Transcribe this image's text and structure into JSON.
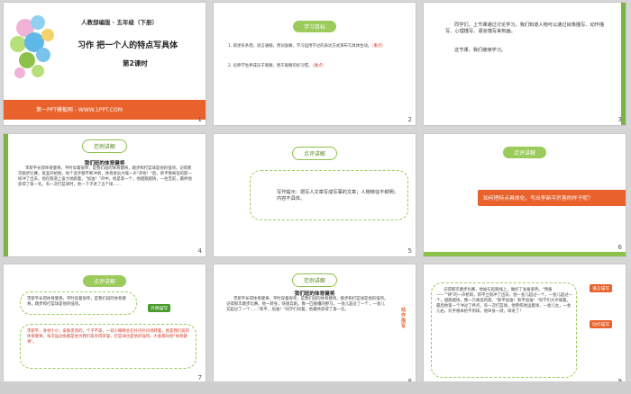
{
  "slides": [
    {
      "num": "1",
      "textbook": "人教部编版 · 五年级（下册）",
      "title": "习作  把一个人的特点写具体",
      "lesson": "第2课时",
      "footer": "第一PPT模板网 - WWW.1PPT.COM"
    },
    {
      "num": "2",
      "tab": "学习目标",
      "items": [
        "1. 叙述有条理，语言通顺，用词准确，学习运用学过的表达方式来布写具体生动。",
        "2. 培养学生养成乐于观察，善于观察的好习惯。"
      ],
      "tags": [
        "（重点）",
        "（难点）"
      ]
    },
    {
      "num": "3",
      "body": "同学们，上节课通过讨论学习，我们知道人物可以通过肖像描写、动作描写、心理描写、语言描写来刻画。",
      "body2": "这节课，我们继续学习。"
    },
    {
      "num": "4",
      "tab": "范例讲解",
      "heading": "我们班的体育健将",
      "body": "李新平长得体育健将，平时穿着很单，是我们班的体育健将，跳步和打篮球是他的强项。记得那次跳步比赛，班里开始跑，每个选手都不断冲刺，体育委员大喊一声\"开始！\"后，新平像离弦的箭一样冲了出去，他在跑道上奋力地跑着，\"加油！\"声中，他是第一个，他越跑越快，一往无前，最终他获得了第一名。有一次打篮球时，他一下子进了五个球……"
    },
    {
      "num": "5",
      "tab": "点评讲解",
      "body": "写作提示：把写人文章写成写事的文章；人物特征不鲜明；内容不具体。"
    },
    {
      "num": "6",
      "tab": "点评讲解",
      "question": "如何把特点具体化，写出李新平厉害的样子呢？"
    },
    {
      "num": "7",
      "tab": "点评讲解",
      "p1": "李新平长得体育健将，平时穿着很单，是我们班的体育健将，跳步和打篮球是他的强项。",
      "p2": "李新平，身材小小，皮肤黑黑的，个子不高，一双小眼睛总在扑闪扑闪地转着，他是我们班的体育健将，每次运动会都是他为我们班争得荣誉，打篮球也是他的强项。大家都叫他\"体育健将\"。",
      "tag": "外貌描写"
    },
    {
      "num": "8",
      "tab": "范例讲解",
      "heading": "我们班的体育健将",
      "body": "李新平长得体育健将，平时穿着很单，是我们班的体育健将，跳步和打篮球是他的强项。记得那次跳步比赛，他一转身，快速奔跑，像一匹脱缰的野马，一会儿超过了一个，一会儿又超过了一个……\"新平，加油！\"同学们叫着，他最终获得了第一名。",
      "side_tag": "动作描写"
    },
    {
      "num": "9",
      "tag1": "语言描写",
      "tag2": "动作描写",
      "body": "记得那次跳步比赛，他站在起跑线上，做好了准备姿势。\"预备——\"\"砰\"的一声枪响，新平立刻冲了出去，他一会儿超过一个，一会儿超过一个，越跑越快，像一只离弦的箭。\"新平加油！新平加油！\"同学们大声喊着。最后他第一个冲过了终点。有一次打篮球，他熟练地运着球，一会儿左，一会儿右，对手根本抢不到球，他纵身一跃，球进了！"
    }
  ]
}
